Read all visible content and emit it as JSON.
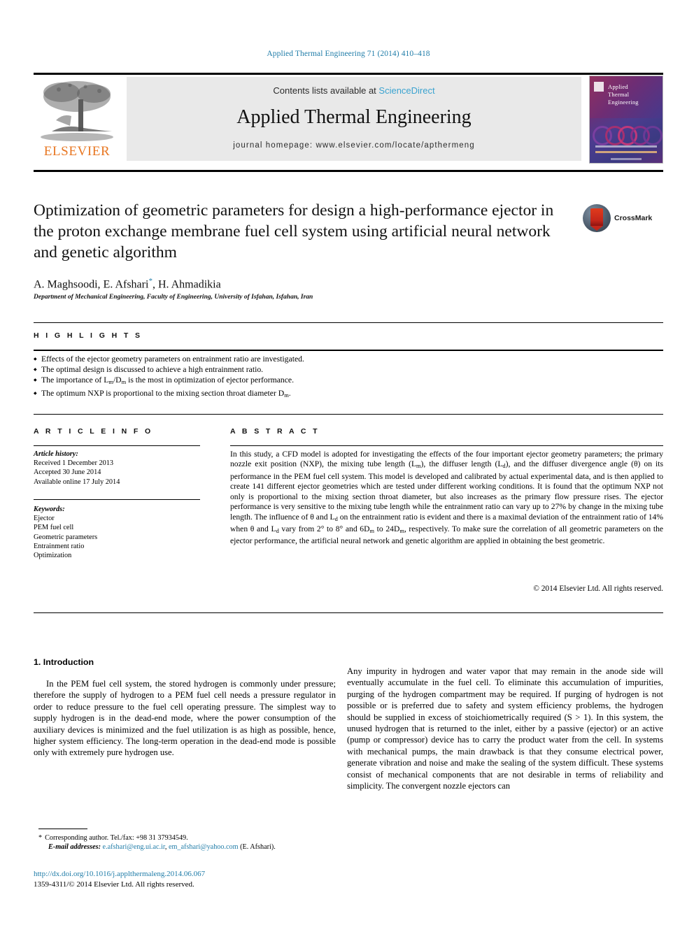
{
  "running_head": "Applied Thermal Engineering 71 (2014) 410–418",
  "masthead": {
    "contents_prefix": "Contents lists available at ",
    "sciencedirect": "ScienceDirect",
    "journal_name": "Applied Thermal Engineering",
    "homepage": "journal homepage: www.elsevier.com/locate/apthermeng",
    "publisher_wordmark": "ELSEVIER",
    "cover_title_lines": [
      "Applied",
      "Thermal",
      "Engineering"
    ]
  },
  "article": {
    "title": "Optimization of geometric parameters for design a high-performance ejector in the proton exchange membrane fuel cell system using artificial neural network and genetic algorithm",
    "authors_prefix": "A. Maghsoodi, E. Afshari",
    "authors_suffix": ", H. Ahmadikia",
    "corresponding_marker": "*",
    "affiliation": "Department of Mechanical Engineering, Faculty of Engineering, University of Isfahan, Isfahan, Iran",
    "crossmark_label": "CrossMark"
  },
  "highlights": {
    "heading": "H I G H L I G H T S",
    "items": [
      "Effects of the ejector geometry parameters on entrainment ratio are investigated.",
      "The optimal design is discussed to achieve a high entrainment ratio.",
      "The importance of Lm/Dm is the most in optimization of ejector performance.",
      "The optimum NXP is proportional to the mixing section throat diameter Dm."
    ]
  },
  "article_info": {
    "heading": "A R T I C L E  I N F O",
    "history_label": "Article history:",
    "history": [
      "Received 1 December 2013",
      "Accepted 30 June 2014",
      "Available online 17 July 2014"
    ],
    "keywords_label": "Keywords:",
    "keywords": [
      "Ejector",
      "PEM fuel cell",
      "Geometric parameters",
      "Entrainment ratio",
      "Optimization"
    ]
  },
  "abstract": {
    "heading": "A B S T R A C T",
    "text": "In this study, a CFD model is adopted for investigating the effects of the four important ejector geometry parameters; the primary nozzle exit position (NXP), the mixing tube length (Lm), the diffuser length (Ld), and the diffuser divergence angle (θ) on its performance in the PEM fuel cell system. This model is developed and calibrated by actual experimental data, and is then applied to create 141 different ejector geometries which are tested under different working conditions. It is found that the optimum NXP not only is proportional to the mixing section throat diameter, but also increases as the primary flow pressure rises. The ejector performance is very sensitive to the mixing tube length while the entrainment ratio can vary up to 27% by change in the mixing tube length. The influence of θ and Ld on the entrainment ratio is evident and there is a maximal deviation of the entrainment ratio of 14% when θ and Ld vary from 2° to 8° and 6Dm to 24Dm, respectively. To make sure the correlation of all geometric parameters on the ejector performance, the artificial neural network and genetic algorithm are applied in obtaining the best geometric.",
    "copyright": "© 2014 Elsevier Ltd. All rights reserved."
  },
  "body": {
    "section_heading": "1. Introduction",
    "left_paragraph": "In the PEM fuel cell system, the stored hydrogen is commonly under pressure; therefore the supply of hydrogen to a PEM fuel cell needs a pressure regulator in order to reduce pressure to the fuel cell operating pressure. The simplest way to supply hydrogen is in the dead-end mode, where the power consumption of the auxiliary devices is minimized and the fuel utilization is as high as possible, hence, higher system efficiency. The long-term operation in the dead-end mode is possible only with extremely pure hydrogen use.",
    "right_paragraph": "Any impurity in hydrogen and water vapor that may remain in the anode side will eventually accumulate in the fuel cell. To eliminate this accumulation of impurities, purging of the hydrogen compartment may be required. If purging of hydrogen is not possible or is preferred due to safety and system efficiency problems, the hydrogen should be supplied in excess of stoichiometrically required (S > 1). In this system, the unused hydrogen that is returned to the inlet, either by a passive (ejector) or an active (pump or compressor) device has to carry the product water from the cell. In systems with mechanical pumps, the main drawback is that they consume electrical power, generate vibration and noise and make the sealing of the system difficult. These systems consist of mechanical components that are not desirable in terms of reliability and simplicity. The convergent nozzle ejectors can"
  },
  "footnote": {
    "star": "*",
    "corresponding": "Corresponding author. Tel./fax: +98 31 37934549.",
    "email_label": "E-mail addresses:",
    "email1": "e.afshari@eng.ui.ac.ir",
    "email_sep": ", ",
    "email2": "em_afshari@yahoo.com",
    "email_owner": " (E. Afshari)."
  },
  "doi_block": {
    "doi_url": "http://dx.doi.org/10.1016/j.applthermaleng.2014.06.067",
    "issn_line": "1359-4311/© 2014 Elsevier Ltd. All rights reserved."
  },
  "colors": {
    "link": "#1f7ca8",
    "sciencedirect": "#3aa3d0",
    "elsevier_orange": "#e87722",
    "masthead_bg": "#e9e9e9"
  }
}
